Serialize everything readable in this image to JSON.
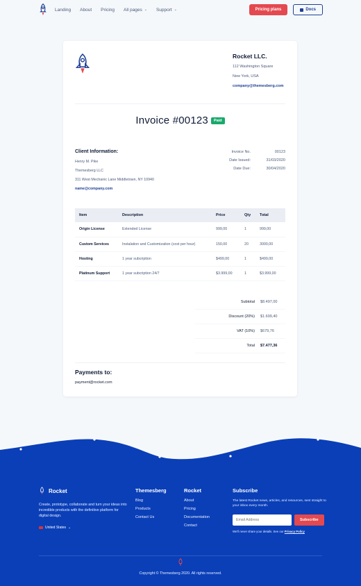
{
  "nav": {
    "links": [
      "Landing",
      "About",
      "Pricing",
      "All pages",
      "Support"
    ],
    "pricing_btn": "Pricing plans",
    "docs_btn": "Docs"
  },
  "company": {
    "name": "Rocket LLC.",
    "address1": "112 Washington Square",
    "address2": "New York, USA",
    "email": "company@themesberg.com"
  },
  "invoice": {
    "title": "Invoice #00123",
    "status": "Paid"
  },
  "client": {
    "heading": "Client Information:",
    "name": "Henry M. Pike",
    "company": "Themesberg LLC",
    "address": "311 West Mechanic Lane Middletown, NY 10940",
    "email": "name@company.com"
  },
  "meta": [
    {
      "label": "Invoice No.",
      "value": "00123"
    },
    {
      "label": "Date Issued:",
      "value": "31/03/2020"
    },
    {
      "label": "Date Due:",
      "value": "30/04/2020"
    }
  ],
  "table": {
    "headers": [
      "Item",
      "Description",
      "Price",
      "Qty",
      "Total"
    ],
    "rows": [
      [
        "Origin License",
        "Extended License",
        "999,00",
        "1",
        "999,00"
      ],
      [
        "Custom Services",
        "Instalation and Customization (cost per hour)",
        "150,00",
        "20",
        "3000,00"
      ],
      [
        "Hosting",
        "1 year subcription",
        "$499,00",
        "1",
        "$499,00"
      ],
      [
        "Platinum Support",
        "1 year subcription 24/7",
        "$3.999,00",
        "1",
        "$3.999,00"
      ]
    ]
  },
  "totals": [
    {
      "label": "Subtotal",
      "value": "$8.497,00"
    },
    {
      "label": "Discount (20%)",
      "value": "$1.699,40"
    },
    {
      "label": "VAT (10%)",
      "value": "$679,76"
    },
    {
      "label": "Total",
      "value": "$7.477,36"
    }
  ],
  "payments": {
    "heading": "Payments to:",
    "email": "payment@rocket.com"
  },
  "footer": {
    "brand": "Rocket",
    "description": "Create, prototype, collaborate and turn your ideas into incredible products with the definitive platform for digital design.",
    "language": "United States",
    "col1": {
      "heading": "Themesberg",
      "links": [
        "Blog",
        "Products",
        "Contact Us"
      ]
    },
    "col2": {
      "heading": "Rocket",
      "links": [
        "About",
        "Pricing",
        "Documentation",
        "Contact"
      ]
    },
    "subscribe": {
      "heading": "Subscribe",
      "description": "The latest Rocket news, articles, and resources, sent straight to your inbox every month.",
      "placeholder": "Email Address",
      "button": "Subscribe",
      "note": "We'll never share your details. See our",
      "policy": "Privacy Policy"
    },
    "copyright": "Copyright © Themesberg 2020. All rights reserved."
  },
  "colors": {
    "primary": "#0a3fb8",
    "accent": "#e4494f",
    "success": "#18a96b"
  }
}
